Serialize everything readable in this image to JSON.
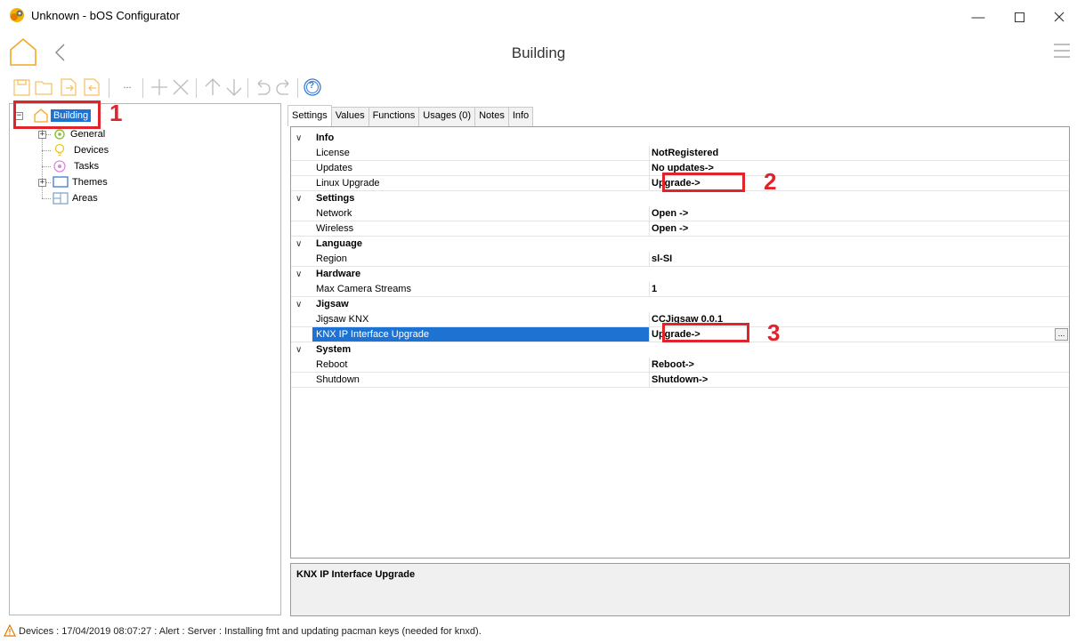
{
  "window": {
    "title": "Unknown - bOS Configurator",
    "minimize_icon": "minimize-icon",
    "maximize_icon": "maximize-icon",
    "close_icon": "close-icon"
  },
  "header": {
    "title": "Building",
    "home_icon": "home-icon",
    "back_icon": "chevron-left-icon",
    "menu_icon": "hamburger-menu-icon"
  },
  "toolbar": {
    "more_label": "...",
    "help_label": "?"
  },
  "tree": {
    "root": {
      "label": "Building"
    },
    "items": [
      {
        "label": "General"
      },
      {
        "label": "Devices"
      },
      {
        "label": "Tasks"
      },
      {
        "label": "Themes"
      },
      {
        "label": "Areas"
      }
    ]
  },
  "tabs": [
    {
      "label": "Settings"
    },
    {
      "label": "Values"
    },
    {
      "label": "Functions"
    },
    {
      "label": "Usages (0)"
    },
    {
      "label": "Notes"
    },
    {
      "label": "Info"
    }
  ],
  "grid": {
    "info": {
      "category": "Info",
      "license": {
        "name": "License",
        "value": "NotRegistered"
      },
      "updates": {
        "name": "Updates",
        "value": "No updates->"
      },
      "linux_upgrade": {
        "name": "Linux Upgrade",
        "value": "Upgrade->"
      }
    },
    "settings": {
      "category": "Settings",
      "network": {
        "name": "Network",
        "value": "Open ->"
      },
      "wireless": {
        "name": "Wireless",
        "value": "Open ->"
      }
    },
    "language": {
      "category": "Language",
      "region": {
        "name": "Region",
        "value": "sl-SI"
      }
    },
    "hardware": {
      "category": "Hardware",
      "max_camera": {
        "name": "Max Camera Streams",
        "value": "1"
      }
    },
    "jigsaw": {
      "category": "Jigsaw",
      "jigsaw_knx": {
        "name": "Jigsaw KNX",
        "value": "CCJigsaw 0.0.1"
      },
      "knx_ip": {
        "name": "KNX IP Interface Upgrade",
        "value": "Upgrade->",
        "button": "..."
      }
    },
    "system": {
      "category": "System",
      "reboot": {
        "name": "Reboot",
        "value": "Reboot->"
      },
      "shutdown": {
        "name": "Shutdown",
        "value": "Shutdown->"
      }
    }
  },
  "description": {
    "title": "KNX IP Interface Upgrade"
  },
  "annotations": {
    "one": "1",
    "two": "2",
    "three": "3",
    "color": "#e0242c"
  },
  "status": {
    "text": "Devices : 17/04/2019 08:07:27 : Alert : Server : Installing fmt and updating pacman keys (needed for knxd).",
    "icon": "warning-icon"
  },
  "colors": {
    "selection": "#1e73d2",
    "icon_orange": "#f5a623"
  }
}
